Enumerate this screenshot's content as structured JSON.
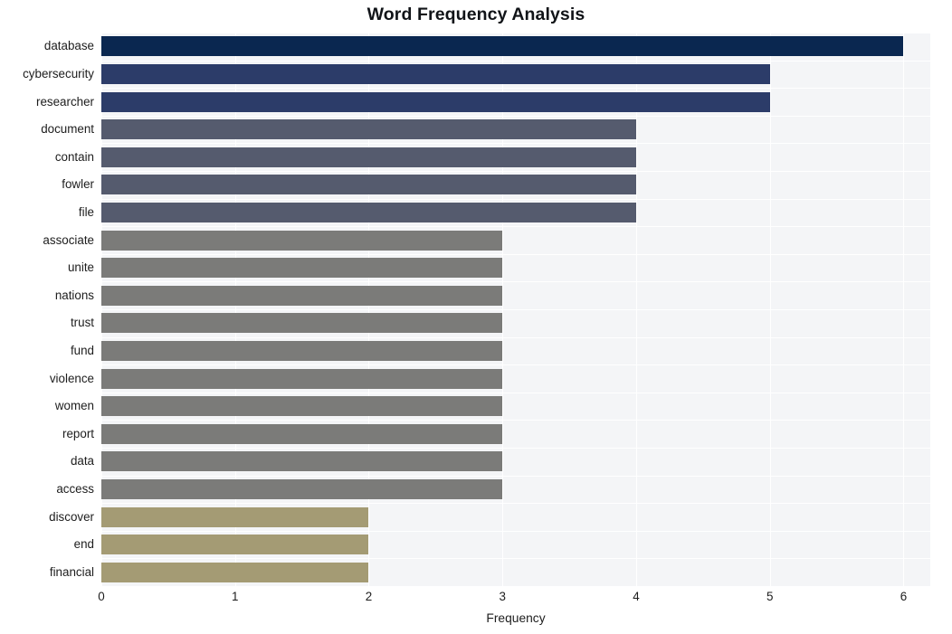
{
  "chart_data": {
    "type": "bar",
    "orientation": "horizontal",
    "title": "Word Frequency Analysis",
    "xlabel": "Frequency",
    "ylabel": "",
    "categories": [
      "database",
      "cybersecurity",
      "researcher",
      "document",
      "contain",
      "fowler",
      "file",
      "associate",
      "unite",
      "nations",
      "trust",
      "fund",
      "violence",
      "women",
      "report",
      "data",
      "access",
      "discover",
      "end",
      "financial"
    ],
    "values": [
      6,
      5,
      5,
      4,
      4,
      4,
      4,
      3,
      3,
      3,
      3,
      3,
      3,
      3,
      3,
      3,
      3,
      2,
      2,
      2
    ],
    "bar_colors": [
      "#0a2750",
      "#2c3c69",
      "#2c3c69",
      "#555b6e",
      "#555b6e",
      "#555b6e",
      "#555b6e",
      "#7b7b79",
      "#7b7b79",
      "#7b7b79",
      "#7b7b79",
      "#7b7b79",
      "#7b7b79",
      "#7b7b79",
      "#7b7b79",
      "#7b7b79",
      "#7b7b79",
      "#a49b74",
      "#a49b74",
      "#a49b74"
    ],
    "xlim": [
      0,
      6.2
    ],
    "xticks": [
      0,
      1,
      2,
      3,
      4,
      5,
      6
    ],
    "xtick_labels": [
      "0",
      "1",
      "2",
      "3",
      "4",
      "5",
      "6"
    ],
    "grid": true,
    "grid_color": "#ffffff",
    "plot_background": "#f4f5f7",
    "figure_background": "#ffffff",
    "legend": null
  }
}
